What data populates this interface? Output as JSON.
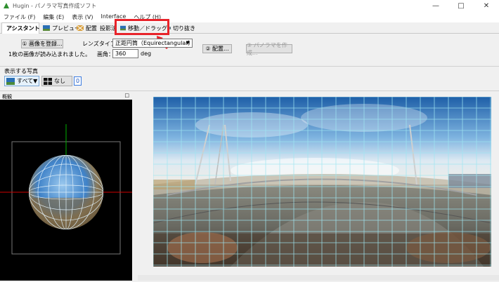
{
  "window": {
    "title": "Hugin - パノラマ写真作成ソフト",
    "controls": [
      "minimize",
      "maximize",
      "close"
    ]
  },
  "menu": [
    "ファイル (F)",
    "編集 (E)",
    "表示 (V)",
    "Interface",
    "ヘルプ (H)"
  ],
  "tabs": [
    {
      "label": "アシスタント",
      "icon": "assistant-icon",
      "active": true
    },
    {
      "label": "プレビュー",
      "icon": "preview-icon"
    },
    {
      "label": "配置",
      "icon": "layout-icon"
    },
    {
      "label": "投影法",
      "icon": ""
    },
    {
      "label": "移動／ドラッグ",
      "icon": "move-icon"
    },
    {
      "label": "切り抜き",
      "icon": "crop-icon"
    }
  ],
  "assistant": {
    "load_images_button": "① 画像を登録...",
    "status_text": "1枚の画像が読み込まれました。",
    "lens_type_label": "レンズタイプ：",
    "lens_type_value": "正距円筒（Equirectangular）",
    "fov_label": "画角：",
    "fov_value": "360",
    "fov_unit": "deg",
    "align_button": "② 配置...",
    "create_button": "③ パノラマを作成..."
  },
  "display_images": {
    "label": "表示する写真",
    "all_button": "すべて▼",
    "none_button": "なし",
    "image_index": "0"
  },
  "overview": {
    "label": "概観"
  },
  "colors": {
    "highlight": "#e8232a",
    "grid_line": "#9fe6f2",
    "axis_red": "#d00000",
    "axis_green": "#00b000"
  }
}
